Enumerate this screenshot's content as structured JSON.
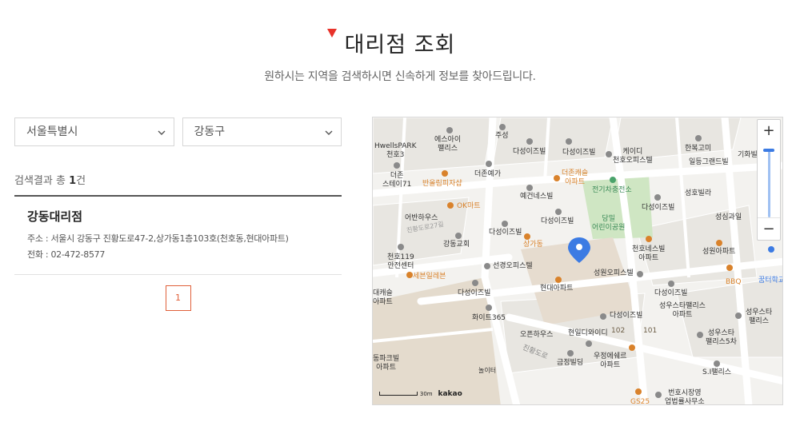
{
  "header": {
    "title": "대리점 조회",
    "subtitle": "원하시는 지역을 검색하시면 신속하게 정보를 찾아드립니다."
  },
  "filters": {
    "city": "서울특별시",
    "district": "강동구"
  },
  "results": {
    "prefix": "검색결과 총 ",
    "count": "1",
    "suffix": "건",
    "items": [
      {
        "name": "강동대리점",
        "address": "주소 : 서울시 강동구 진황도로47-2,상가동1층103호(천호동,현대아파트)",
        "phone": "전화 : 02-472-8577"
      }
    ]
  },
  "pagination": {
    "current": "1"
  },
  "map": {
    "zoom_in": "+",
    "zoom_out": "−",
    "scale_text": "30m",
    "brand": "kakao",
    "labels": [
      {
        "text": "에스아이\n팰리스"
      },
      {
        "text": "주성"
      },
      {
        "text": "다성이즈빌"
      },
      {
        "text": "다성이즈빌"
      },
      {
        "text": "케이디\n천호오피스텔"
      },
      {
        "text": "한복고미"
      },
      {
        "text": "일등그랜드빌"
      },
      {
        "text": "기화빌라"
      },
      {
        "text": "HwellsPARK\n천호3"
      },
      {
        "text": "더존\n스테이71"
      },
      {
        "text": "더존예가"
      },
      {
        "text": "반올림피자샵"
      },
      {
        "text": "더존캐슬\n아파트"
      },
      {
        "text": "전기차충전소"
      },
      {
        "text": "예건네스빌"
      },
      {
        "text": "다성이즈빌"
      },
      {
        "text": "성호빌라"
      },
      {
        "text": "어반하우스"
      },
      {
        "text": "OK마트"
      },
      {
        "text": "다성이즈빌"
      },
      {
        "text": "당밀\n어린이공원"
      },
      {
        "text": "성심과일"
      },
      {
        "text": "다성이즈빌"
      },
      {
        "text": "상가동"
      },
      {
        "text": "강동교회"
      },
      {
        "text": "천호네스빌\n아파트"
      },
      {
        "text": "성원아파트"
      },
      {
        "text": "천호119\n안전센터"
      },
      {
        "text": "세븐일레븐"
      },
      {
        "text": "선경오피스텔"
      },
      {
        "text": "성원오피스텔"
      },
      {
        "text": "BBQ"
      },
      {
        "text": "꿈터학교"
      },
      {
        "text": "다성이즈빌"
      },
      {
        "text": "현대아파트"
      },
      {
        "text": "다성이즈빌"
      },
      {
        "text": "대캐슬\n아파트"
      },
      {
        "text": "성우스타팰리스\n아파트"
      },
      {
        "text": "성우스타\n팰리스"
      },
      {
        "text": "화이트365"
      },
      {
        "text": "다성이즈빌"
      },
      {
        "text": "오픈하우스"
      },
      {
        "text": "현일디와이디"
      },
      {
        "text": "성우스타\n팰리스5차"
      },
      {
        "text": "우정에쉐르\n아파트"
      },
      {
        "text": "금정빌딩"
      },
      {
        "text": "동파크빌\n아파트"
      },
      {
        "text": "놀이터"
      },
      {
        "text": "S.I팰리스"
      },
      {
        "text": "GS25"
      },
      {
        "text": "번호시장영\n업법률사무소"
      },
      {
        "text": "진황도로27길"
      },
      {
        "text": "진황도로"
      },
      {
        "text": "101"
      },
      {
        "text": "102"
      }
    ]
  }
}
